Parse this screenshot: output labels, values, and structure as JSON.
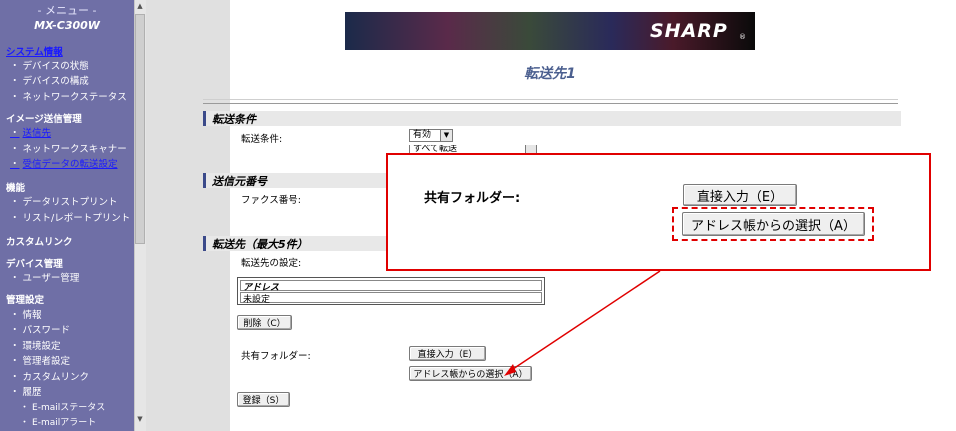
{
  "sidebar": {
    "menu_title": "- メニュー -",
    "model": "MX-C300W",
    "groups": [
      {
        "head": "システム情報",
        "items": [
          "デバイスの状態",
          "デバイスの構成",
          "ネットワークステータス"
        ]
      },
      {
        "head": "イメージ送信管理",
        "items": [
          "送信先",
          "ネットワークスキャナー",
          "受信データの転送設定"
        ]
      },
      {
        "head": "機能",
        "items": [
          "データリストプリント",
          "リスト/レポートプリント"
        ]
      },
      {
        "head": "カスタムリンク",
        "items": []
      },
      {
        "head": "デバイス管理",
        "items": [
          "ユーザー管理"
        ]
      },
      {
        "head": "管理設定",
        "items": [
          "情報",
          "パスワード",
          "環境設定",
          "管理者設定",
          "カスタムリンク",
          "履歴"
        ]
      }
    ],
    "sub_items": [
      "E-mailステータス",
      "E-mailアラート"
    ]
  },
  "header": {
    "brand": "SHARP",
    "page_title": "転送先1"
  },
  "sections": {
    "transfer_conditions": "転送条件",
    "sender_number": "送信元番号",
    "destination": "転送先（最大5件）"
  },
  "form": {
    "condition_label": "転送条件:",
    "condition_value": "有効",
    "condition_second_value": "すべて転送",
    "fax_label": "ファクス番号:",
    "dest_setting_label": "転送先の設定:",
    "table_header": "アドレス",
    "table_row": "未設定",
    "delete_button": "削除（C）",
    "shared_folder_label": "共有フォルダー:",
    "direct_input_button": "直接入力（E）",
    "address_book_button": "アドレス帳からの選択（A）",
    "register_button": "登録（S）"
  },
  "callout": {
    "label": "共有フォルダー:",
    "direct_input_button": "直接入力（E）",
    "address_book_button": "アドレス帳からの選択（A）"
  },
  "icons": {
    "dropdown": "chevron-down-icon"
  },
  "colors": {
    "sidebar": "#6f6fa6",
    "accent": "#e00000",
    "title": "#4b5f8f",
    "section_bar": "#3b4a8a"
  }
}
